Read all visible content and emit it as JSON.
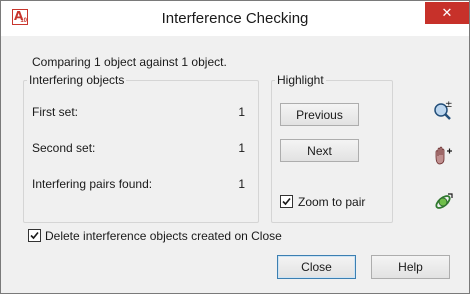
{
  "window": {
    "title": "Interference Checking",
    "app_icon_letter": "A",
    "app_icon_version": "10",
    "close_glyph": "✕"
  },
  "status_text": "Comparing 1 object against 1 object.",
  "interfering": {
    "legend": "Interfering objects",
    "first_set_label": "First set:",
    "first_set_value": "1",
    "second_set_label": "Second set:",
    "second_set_value": "1",
    "pairs_label": "Interfering pairs found:",
    "pairs_value": "1"
  },
  "highlight": {
    "legend": "Highlight",
    "previous_label": "Previous",
    "next_label": "Next",
    "zoom_label": "Zoom to pair",
    "zoom_checked": true
  },
  "side_icons": [
    "zoom-realtime-icon",
    "pan-hand-icon",
    "orbit-icon"
  ],
  "delete_option": {
    "label": "Delete interference objects created on Close",
    "checked": true
  },
  "footer": {
    "close_label": "Close",
    "help_label": "Help"
  },
  "colors": {
    "title_close_bg": "#c7312a",
    "dialog_bg": "#f0f0f0",
    "default_button_border": "#3c7fb1"
  }
}
